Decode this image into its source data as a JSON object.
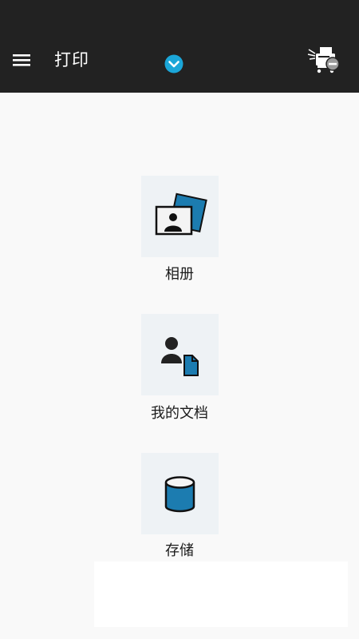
{
  "header": {
    "title": "打印",
    "menu_icon": "hamburger-menu-icon",
    "dropdown_icon": "chevron-down-circle-icon",
    "printer_icon": "printer-disconnected-icon",
    "accent_color": "#1ba6d8"
  },
  "tiles": [
    {
      "label": "相册",
      "icon": "photo-album-icon"
    },
    {
      "label": "我的文档",
      "icon": "documents-icon"
    },
    {
      "label": "存储",
      "icon": "storage-icon"
    }
  ],
  "colors": {
    "header_bg": "#222222",
    "page_bg": "#f9f9f9",
    "tile_bg": "#eef2f5",
    "icon_blue": "#1c7cb0"
  }
}
